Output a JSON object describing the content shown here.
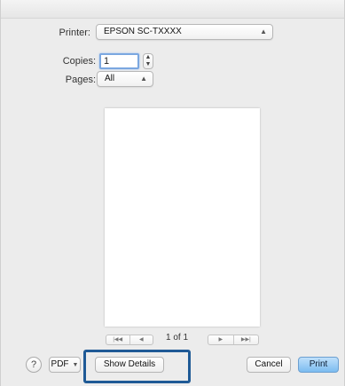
{
  "printer": {
    "label": "Printer:",
    "value": "EPSON SC-TXXXX"
  },
  "copies": {
    "label": "Copies:",
    "value": "1"
  },
  "pages": {
    "label": "Pages:",
    "value": "All"
  },
  "preview": {
    "page_indicator": "1 of 1"
  },
  "footer": {
    "help": "?",
    "pdf_label": "PDF",
    "show_details_label": "Show Details",
    "cancel_label": "Cancel",
    "print_label": "Print"
  },
  "colors": {
    "highlight_border": "#1f5a96",
    "primary_button": "#7cbcf0"
  }
}
